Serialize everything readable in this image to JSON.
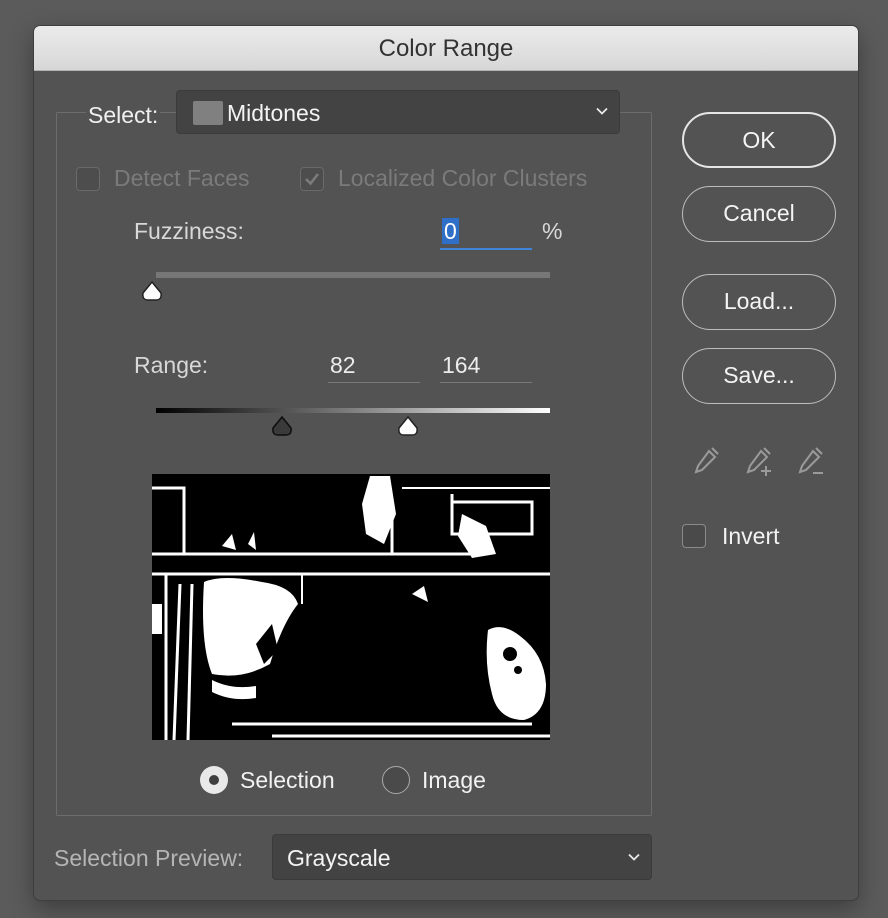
{
  "dialog": {
    "title": "Color Range"
  },
  "select": {
    "label": "Select:",
    "value": "Midtones",
    "swatch_color": "#808080"
  },
  "options": {
    "detect_faces": {
      "label": "Detect Faces",
      "checked": false,
      "enabled": false
    },
    "localized_clusters": {
      "label": "Localized Color Clusters",
      "checked": true,
      "enabled": false
    }
  },
  "fuzziness": {
    "label": "Fuzziness:",
    "value": "0",
    "unit": "%",
    "slider_fraction": 0
  },
  "range": {
    "label": "Range:",
    "low": "82",
    "high": "164",
    "low_fraction": 0.32,
    "high_fraction": 0.64
  },
  "preview_mode": {
    "selection_label": "Selection",
    "image_label": "Image",
    "selected": "Selection"
  },
  "buttons": {
    "ok": "OK",
    "cancel": "Cancel",
    "load": "Load...",
    "save": "Save..."
  },
  "eyedroppers": [
    "eyedropper-icon",
    "eyedropper-plus-icon",
    "eyedropper-minus-icon"
  ],
  "invert": {
    "label": "Invert",
    "checked": false
  },
  "selection_preview": {
    "label": "Selection Preview:",
    "value": "Grayscale"
  },
  "colors": {
    "dialog_bg": "#535353",
    "title_bg": "#e0e0e0",
    "focus_accent": "#3f84d9"
  }
}
